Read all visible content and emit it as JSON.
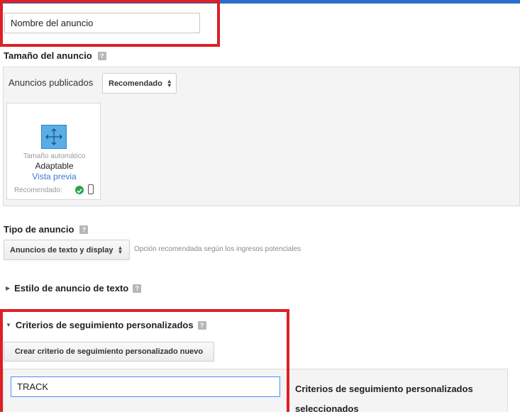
{
  "ad_name": {
    "value": "Nombre del anuncio"
  },
  "ad_size": {
    "title": "Tamaño del anuncio",
    "help": "?",
    "published_label": "Anuncios publicados",
    "filter_select": "Recomendado",
    "card": {
      "subtitle": "Tamaño automático",
      "title": "Adaptable",
      "preview_link": "Vista previa",
      "recommended_label": "Recomendado:"
    }
  },
  "ad_type": {
    "title": "Tipo de anuncio",
    "help": "?",
    "select_value": "Anuncios de texto y display",
    "hint": "Opción recomendada según los ingresos potenciales"
  },
  "text_style": {
    "title": "Estilo de anuncio de texto",
    "help": "?"
  },
  "custom_channels": {
    "title": "Criterios de seguimiento personalizados",
    "help": "?",
    "create_button": "Crear criterio de seguimiento personalizado nuevo",
    "search_value": "TRACK",
    "selected_title": "Criterios de seguimiento personalizados seleccionados"
  },
  "colors": {
    "accent": "#2c6ecb",
    "highlight": "#dd1f26",
    "link": "#3b78d8",
    "check": "#2aa54a",
    "tile": "#5aaee8"
  }
}
